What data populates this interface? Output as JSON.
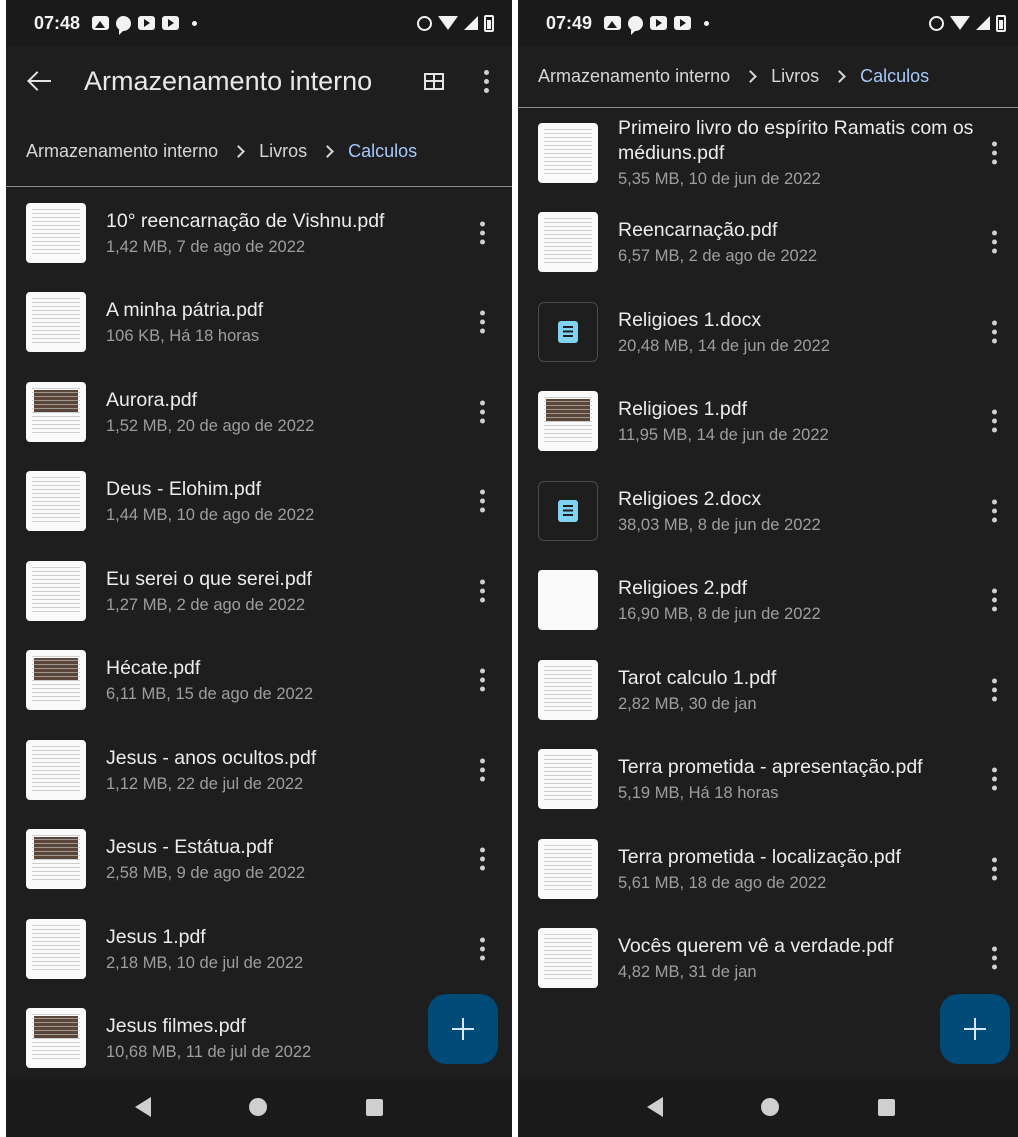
{
  "left": {
    "status": {
      "time": "07:48"
    },
    "appbar": {
      "title": "Armazenamento interno"
    },
    "breadcrumb": {
      "items": [
        "Armazenamento interno",
        "Livros",
        "Calculos"
      ]
    },
    "files": [
      {
        "name": "10° reencarnação de Vishnu.pdf",
        "meta": "1,42 MB, 7 de ago de 2022",
        "thumb": "pdf"
      },
      {
        "name": "A minha pátria.pdf",
        "meta": "106 KB, Há 18 horas",
        "thumb": "pdf"
      },
      {
        "name": "Aurora.pdf",
        "meta": "1,52 MB, 20 de ago de 2022",
        "thumb": "pdf-photo"
      },
      {
        "name": "Deus - Elohim.pdf",
        "meta": "1,44 MB, 10 de ago de 2022",
        "thumb": "pdf"
      },
      {
        "name": "Eu serei o que serei.pdf",
        "meta": "1,27 MB, 2 de ago de 2022",
        "thumb": "pdf"
      },
      {
        "name": "Hécate.pdf",
        "meta": "6,11 MB, 15 de ago de 2022",
        "thumb": "pdf-photo"
      },
      {
        "name": "Jesus - anos ocultos.pdf",
        "meta": "1,12 MB, 22 de jul de 2022",
        "thumb": "pdf"
      },
      {
        "name": "Jesus - Estátua.pdf",
        "meta": "2,58 MB, 9 de ago de 2022",
        "thumb": "pdf-photo"
      },
      {
        "name": "Jesus 1.pdf",
        "meta": "2,18 MB, 10 de jul de 2022",
        "thumb": "pdf"
      },
      {
        "name": "Jesus filmes.pdf",
        "meta": "10,68 MB, 11 de jul de 2022",
        "thumb": "pdf-photo"
      }
    ]
  },
  "right": {
    "status": {
      "time": "07:49"
    },
    "breadcrumb": {
      "items": [
        "Armazenamento interno",
        "Livros",
        "Calculos"
      ]
    },
    "files": [
      {
        "name": "Primeiro livro do espírito Ramatis com os médiuns.pdf",
        "meta": "5,35 MB, 10 de jun de 2022",
        "thumb": "pdf"
      },
      {
        "name": "Reencarnação.pdf",
        "meta": "6,57 MB, 2 de ago de 2022",
        "thumb": "pdf"
      },
      {
        "name": "Religioes 1.docx",
        "meta": "20,48 MB, 14 de jun de 2022",
        "thumb": "docx"
      },
      {
        "name": "Religioes 1.pdf",
        "meta": "11,95 MB, 14 de jun de 2022",
        "thumb": "pdf-photo"
      },
      {
        "name": "Religioes 2.docx",
        "meta": "38,03 MB, 8 de jun de 2022",
        "thumb": "docx"
      },
      {
        "name": "Religioes 2.pdf",
        "meta": "16,90 MB, 8 de jun de 2022",
        "thumb": "blank"
      },
      {
        "name": "Tarot calculo 1.pdf",
        "meta": "2,82 MB, 30 de jan",
        "thumb": "pdf"
      },
      {
        "name": "Terra prometida - apresentação.pdf",
        "meta": "5,19 MB, Há 18 horas",
        "thumb": "pdf"
      },
      {
        "name": "Terra prometida - localização.pdf",
        "meta": "5,61 MB, 18 de ago de 2022",
        "thumb": "pdf"
      },
      {
        "name": "Vocês querem vê a verdade.pdf",
        "meta": "4,82 MB, 31 de jan",
        "thumb": "pdf"
      }
    ]
  },
  "icons": {
    "back": "arrow-back-icon",
    "grid": "grid-view-icon",
    "more": "more-vert-icon",
    "fab": "plus-icon",
    "docx": "document-icon"
  },
  "colors": {
    "background": "#1e1e1f",
    "accent": "#a8c7fa",
    "fab": "#004a77"
  }
}
